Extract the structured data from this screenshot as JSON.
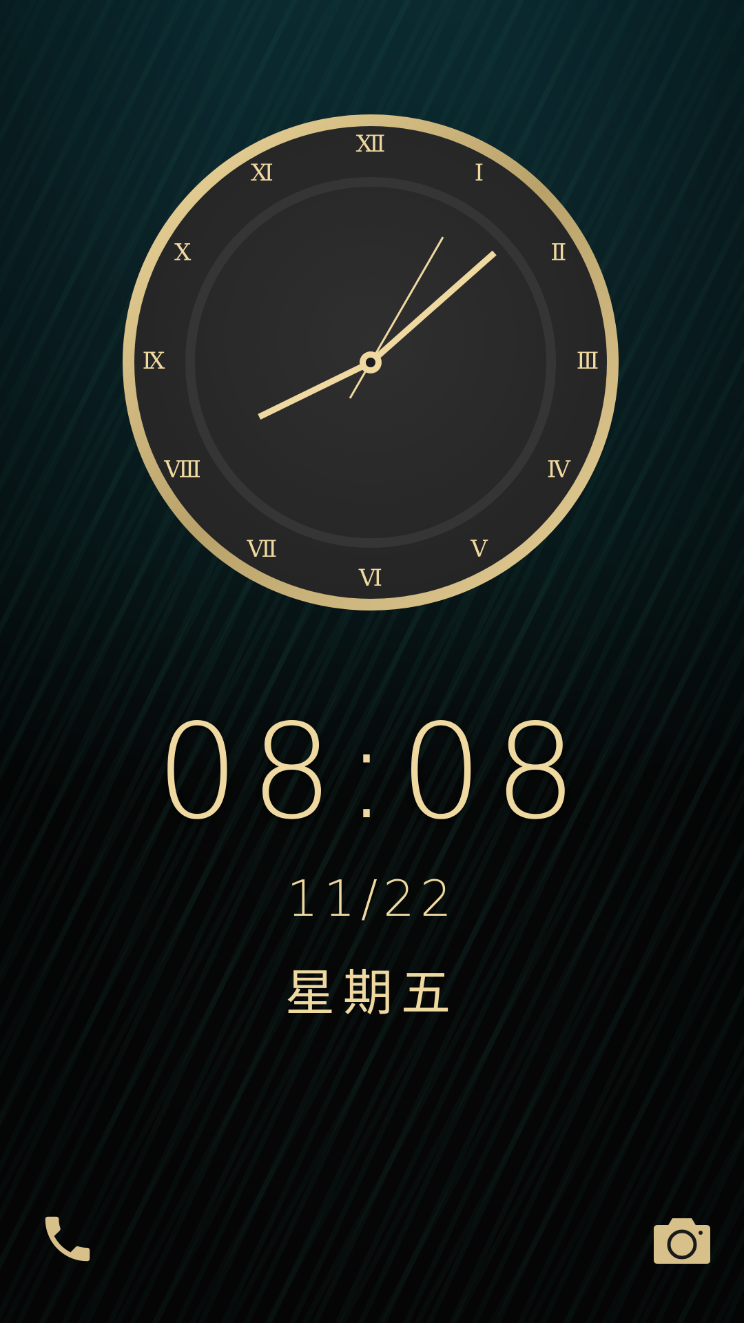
{
  "analog_clock": {
    "numerals": [
      "Ⅻ",
      "Ⅰ",
      "Ⅱ",
      "Ⅲ",
      "Ⅳ",
      "Ⅴ",
      "Ⅵ",
      "Ⅶ",
      "Ⅷ",
      "Ⅸ",
      "Ⅹ",
      "Ⅺ"
    ],
    "hour": 8,
    "minute": 8,
    "second": 5,
    "colors": {
      "gold": "#efd9a0",
      "bezel": "#c8b27a",
      "face": "#2a2a2a"
    }
  },
  "lockscreen": {
    "time": "08:08",
    "date": "11/22",
    "weekday": "星期五"
  },
  "shortcuts": {
    "left_icon": "phone-icon",
    "right_icon": "camera-icon"
  }
}
